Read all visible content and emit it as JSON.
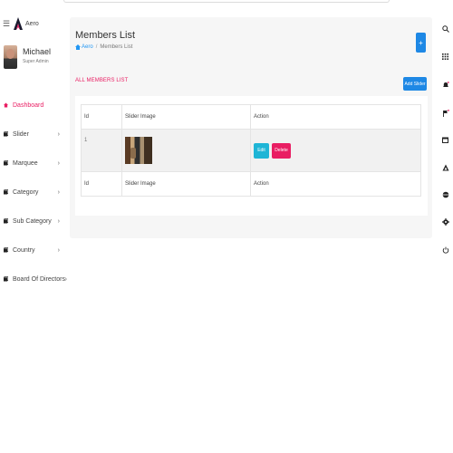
{
  "app": {
    "brand": "Aero"
  },
  "user": {
    "name": "Michael",
    "role": "Super Admin"
  },
  "sidebar": {
    "items": [
      {
        "label": "Dashboard"
      },
      {
        "label": "Slider"
      },
      {
        "label": "Marquee"
      },
      {
        "label": "Category"
      },
      {
        "label": "Sub Category"
      },
      {
        "label": "Country"
      },
      {
        "label": "Board Of Directors"
      }
    ]
  },
  "header": {
    "title": "Members List",
    "breadcrumb": [
      "Aero",
      "Members List"
    ],
    "fab_label": "+"
  },
  "section": {
    "label": "ALL MEMBERS LIST",
    "add_button": "Add Slider"
  },
  "table": {
    "headers": [
      "Id",
      "Slider Image",
      "Action"
    ],
    "rows": [
      {
        "id": "1",
        "edit": "Edit",
        "delete": "Delete"
      }
    ],
    "footers": [
      "Id",
      "Slider Image",
      "Action"
    ]
  },
  "colors": {
    "accent": "#e91e63",
    "primary": "#1e88e5",
    "info": "#1fb5d6"
  },
  "right_rail_icons": [
    "search-icon",
    "apps-icon",
    "bell-icon",
    "flag-icon",
    "calendar-icon",
    "theme-icon",
    "language-icon",
    "settings-icon",
    "power-icon"
  ]
}
